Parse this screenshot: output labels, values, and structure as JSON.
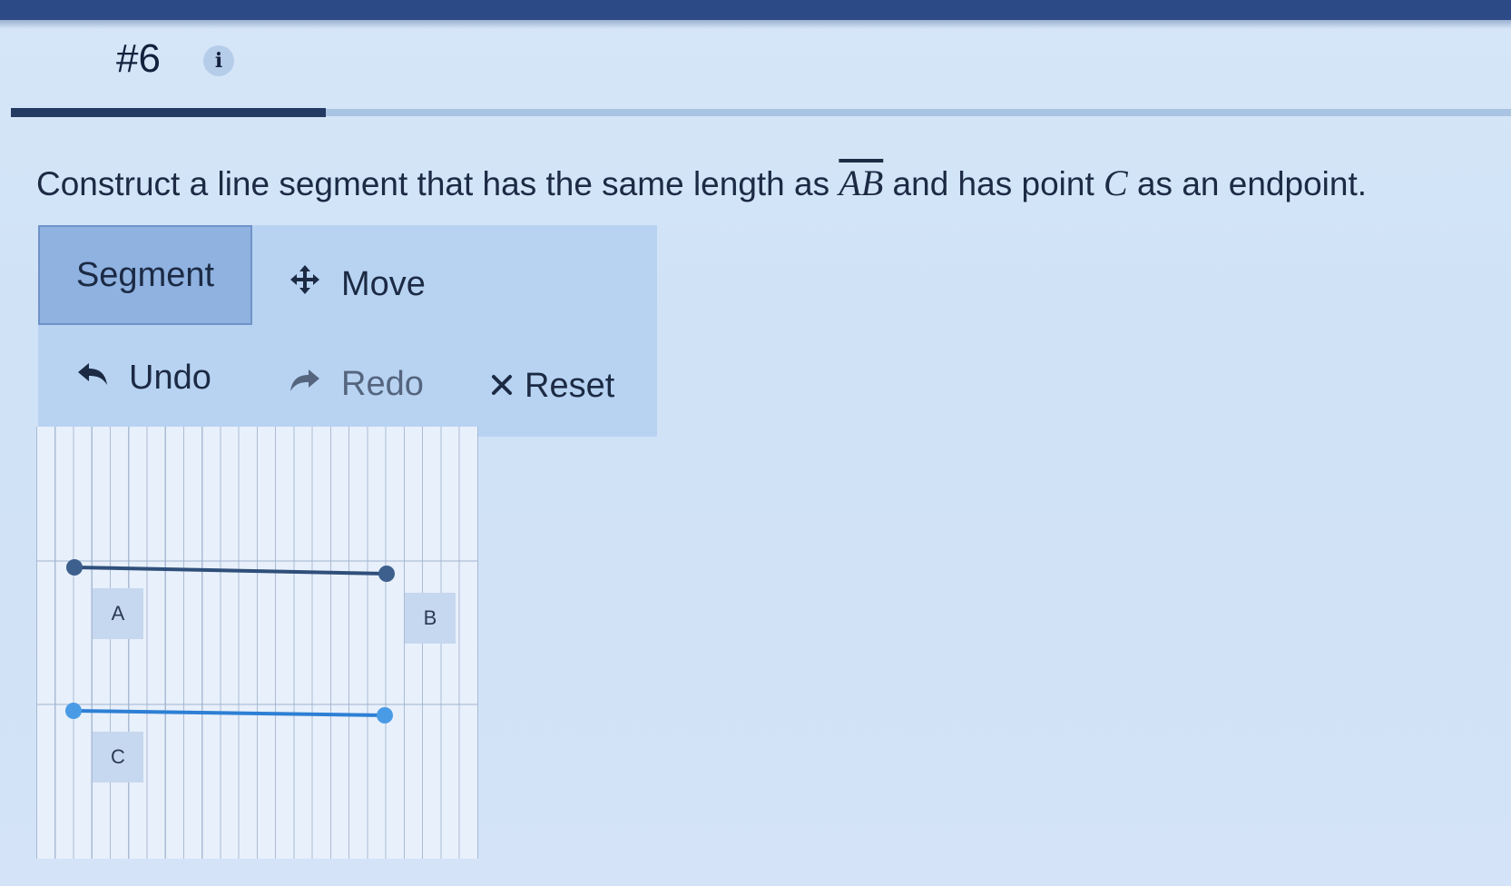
{
  "header": {
    "question_number": "#6",
    "info_icon": "info-icon",
    "info_glyph": "i",
    "progress_percent": 21
  },
  "prompt": {
    "text_before": "Construct a line segment that has the same length as ",
    "segment_name": "AB",
    "text_middle": " and has point ",
    "point_name": "C",
    "text_after": " as an endpoint."
  },
  "toolbar": {
    "segment_label": "Segment",
    "move_label": "Move",
    "move_icon": "move-arrows-icon",
    "undo_label": "Undo",
    "undo_icon": "undo-arrow-icon",
    "redo_label": "Redo",
    "redo_icon": "redo-arrow-icon",
    "reset_label": "Reset",
    "reset_icon": "close-x-icon"
  },
  "canvas": {
    "points": {
      "A": "A",
      "B": "B",
      "C": "C"
    }
  },
  "colors": {
    "top_bar": "#2c4a86",
    "segment_ab": "#2f4f7a",
    "segment_c": "#2d7fd4",
    "point_c_fill": "#4a9be6"
  }
}
